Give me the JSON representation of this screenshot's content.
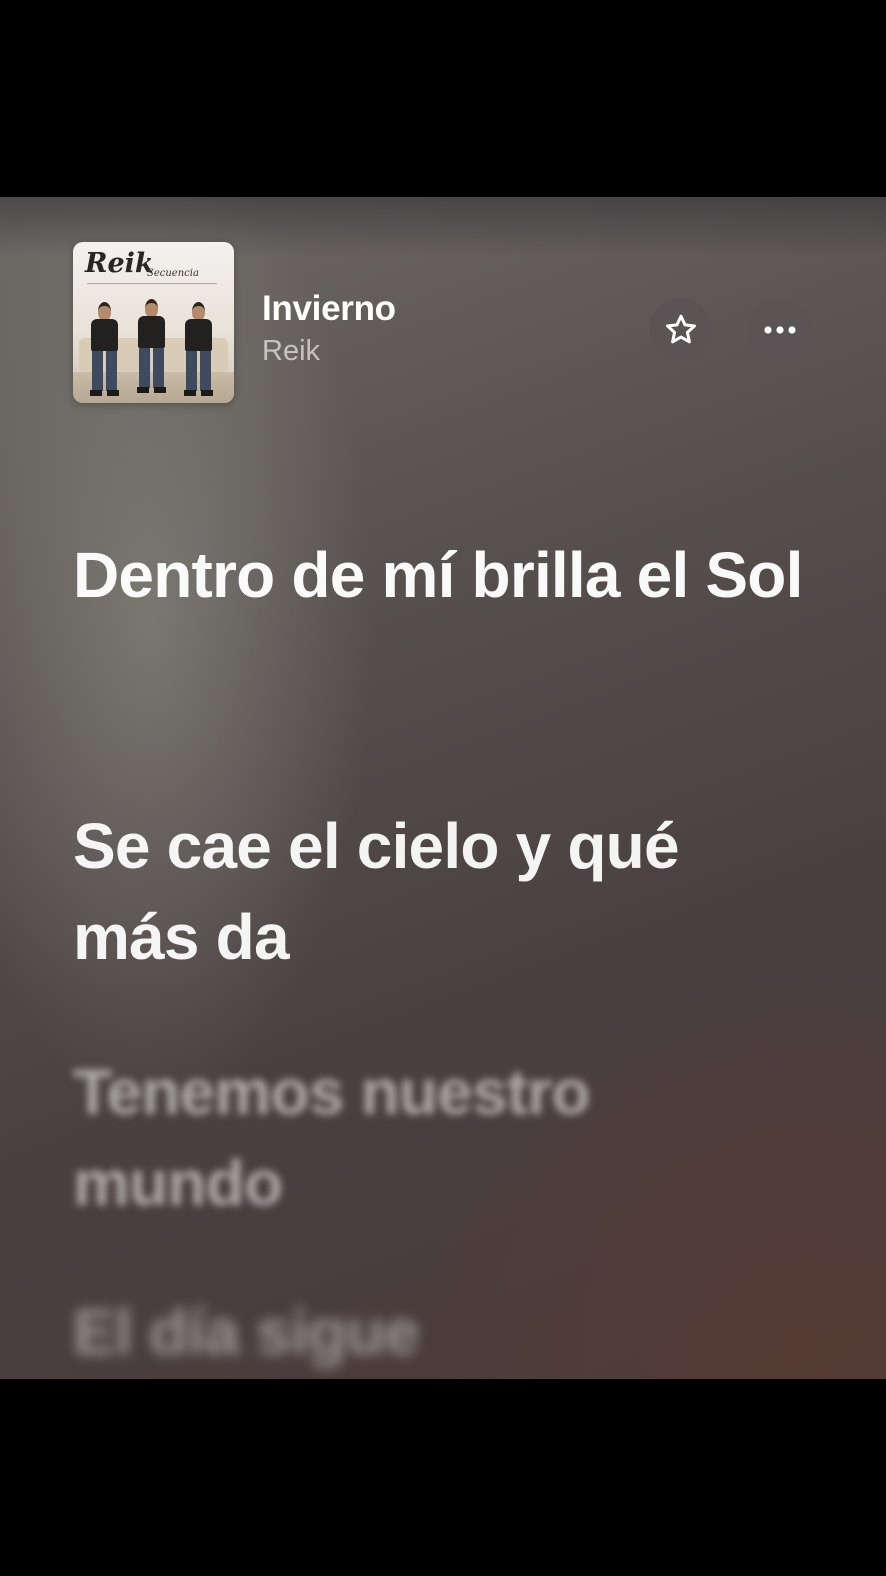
{
  "now_playing": {
    "title": "Invierno",
    "artist": "Reik",
    "artwork": {
      "logo_text": "Reik",
      "subtitle_text": "Secuencia"
    },
    "buttons": {
      "favorite_icon": "star-outline-icon",
      "more_icon": "ellipsis-icon"
    }
  },
  "lyrics": {
    "lines": [
      "Dentro de mí brilla el Sol",
      "Se cae el cielo y qué más da",
      "Tenemos nuestro mundo",
      "El día sigue"
    ]
  },
  "colors": {
    "text_primary": "#ffffff",
    "button_bg": "#5a5456",
    "background_top": "#6e6a66",
    "background_bottom": "#4b3a37"
  }
}
